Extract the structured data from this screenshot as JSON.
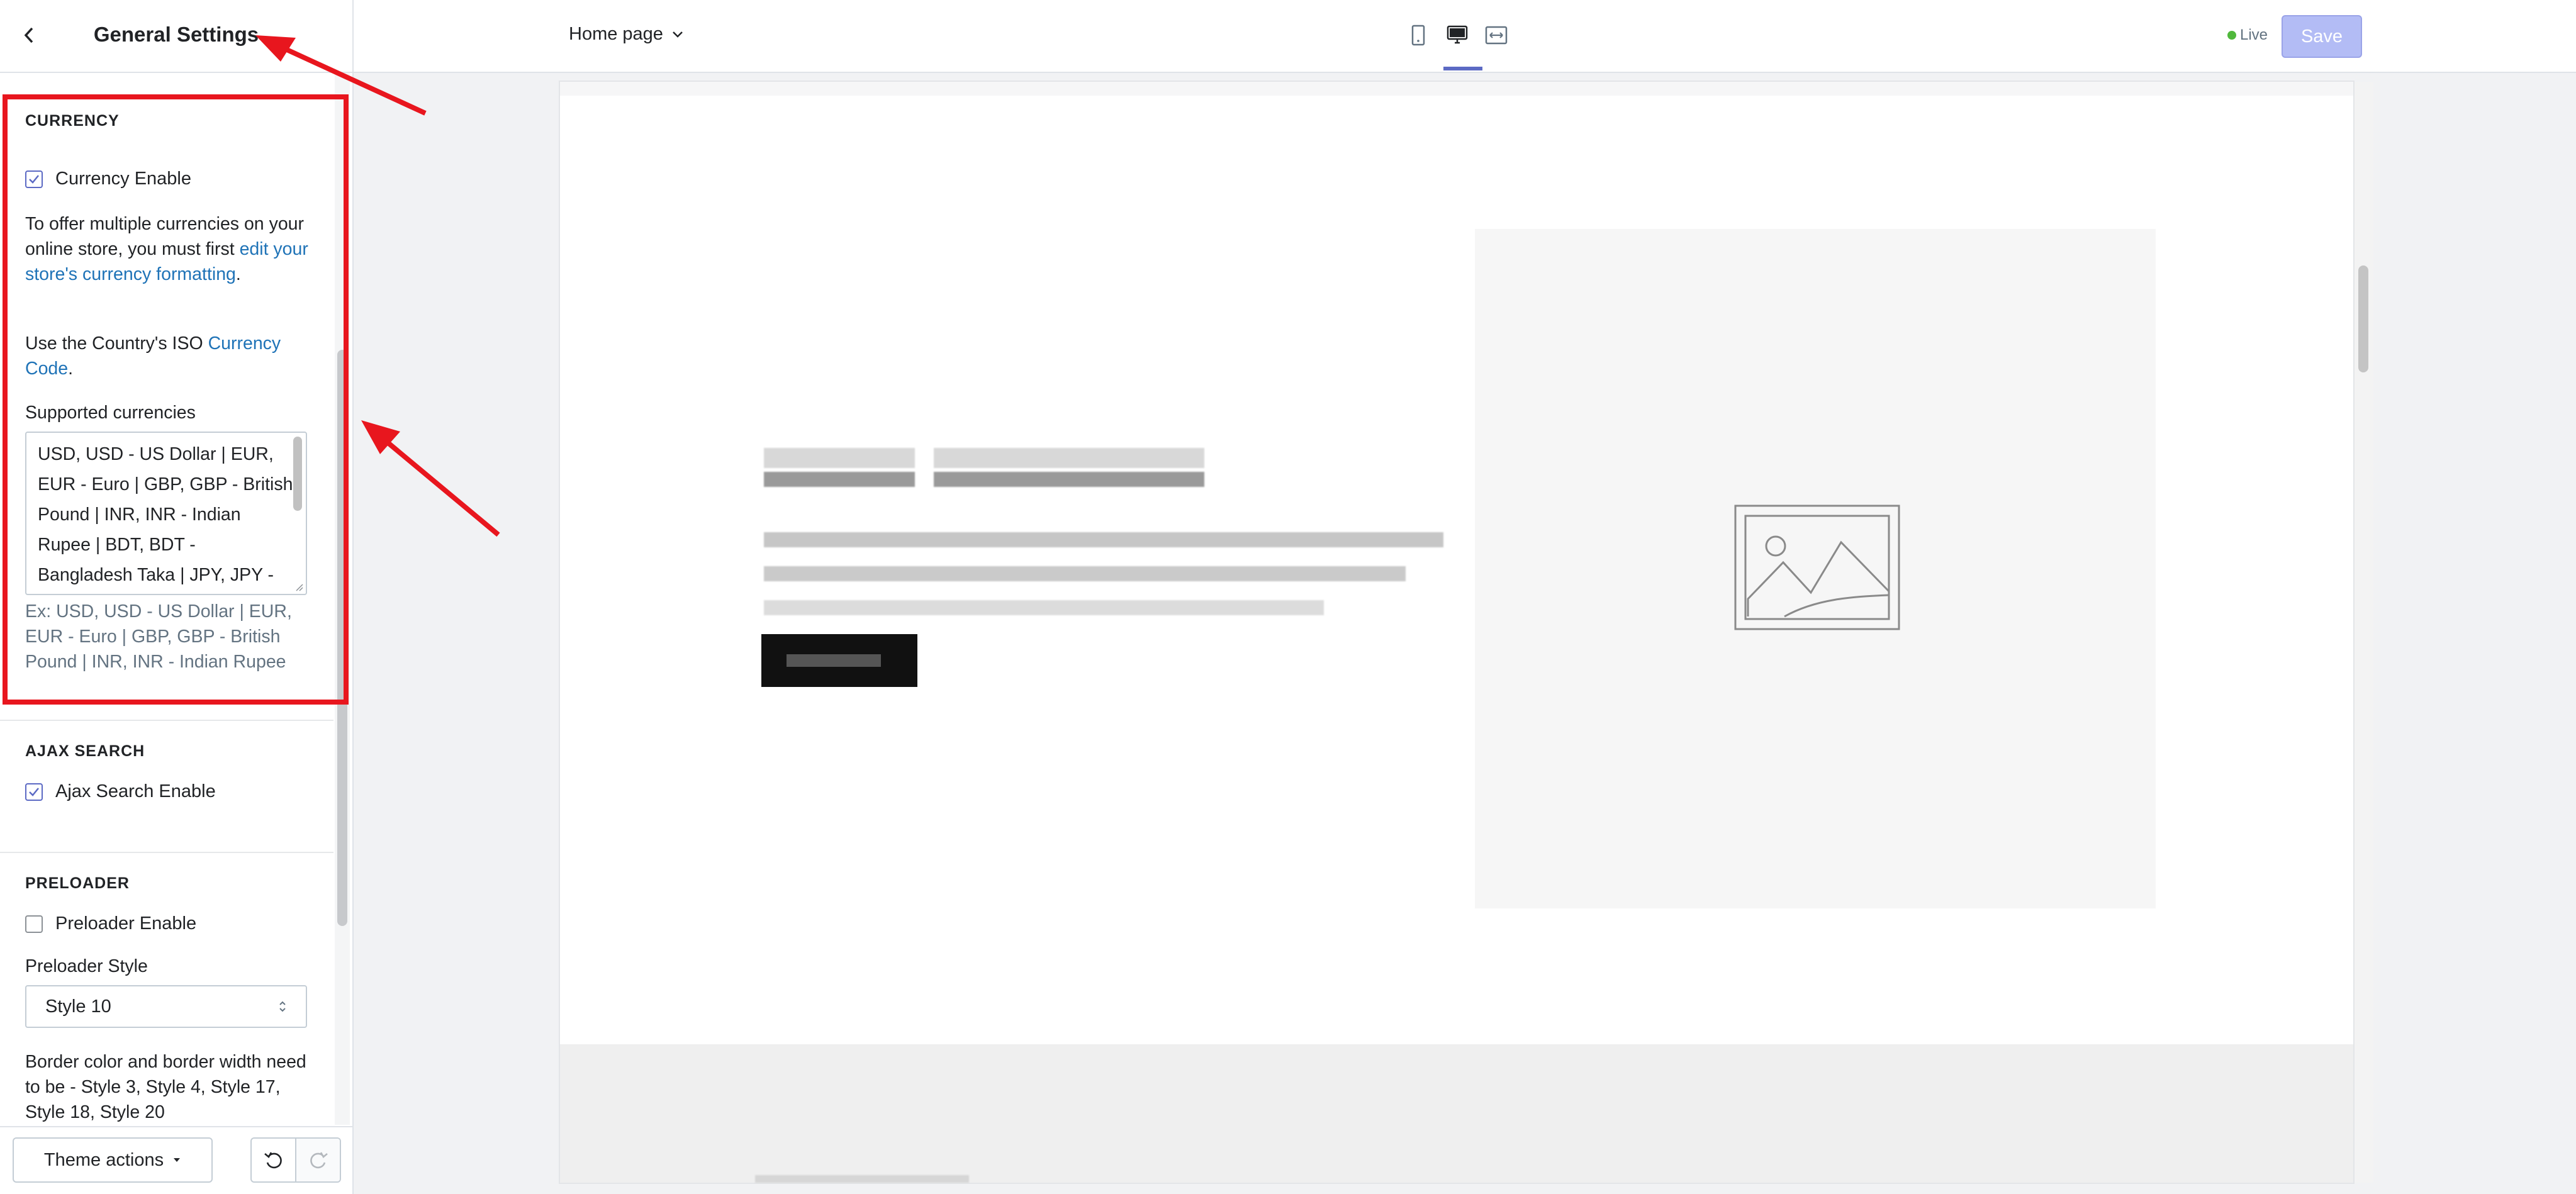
{
  "sidebar": {
    "title": "General Settings",
    "currency": {
      "section_title": "CURRENCY",
      "enable_label": "Currency Enable",
      "info_text": "To offer multiple currencies on your online store, you must first ",
      "info_link": "edit your store's currency formatting",
      "info_end": ".",
      "iso_text": "Use the Country's ISO ",
      "iso_link": "Currency Code",
      "iso_end": ".",
      "supported_label": "Supported currencies",
      "supported_value": "USD, USD - US Dollar | EUR, EUR - Euro | GBP, GBP - British Pound | INR, INR - Indian Rupee | BDT, BDT - Bangladesh Taka | JPY, JPY -",
      "example_help": "Ex: USD, USD - US Dollar | EUR, EUR - Euro | GBP, GBP - British Pound | INR, INR - Indian Rupee"
    },
    "ajax_search": {
      "section_title": "AJAX SEARCH",
      "enable_label": "Ajax Search Enable"
    },
    "preloader": {
      "section_title": "PRELOADER",
      "enable_label": "Preloader Enable",
      "style_label": "Preloader Style",
      "style_value": "Style 10",
      "note": "Border color and border width need to be - Style 3, Style 4, Style 17, Style 18, Style 20"
    },
    "footer": {
      "theme_actions": "Theme actions"
    }
  },
  "topbar": {
    "page_select": "Home page",
    "live_label": "Live",
    "save_label": "Save"
  },
  "colors": {
    "accent": "#5c6ac4",
    "link": "#1f73b7",
    "annotation_red": "#e8161e",
    "live_green": "#50b83c"
  }
}
